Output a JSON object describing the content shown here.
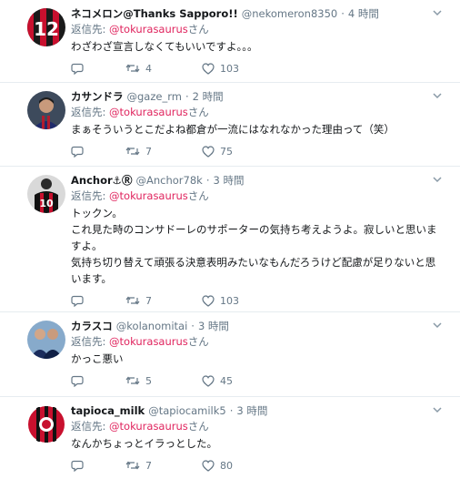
{
  "tweets": [
    {
      "name": "ネコメロン@Thanks Sapporo!!",
      "handle": "@nekomeron8350",
      "sep": "·",
      "time": "4 時間",
      "reply_prefix": "返信先: ",
      "reply_to": "@tokurasaurus",
      "reply_suffix": "さん",
      "text": "わざわざ宣言しなくてもいいですよ。。。",
      "retweets": "4",
      "likes": "103"
    },
    {
      "name": "カサンドラ",
      "handle": "@gaze_rm",
      "sep": "·",
      "time": "2 時間",
      "reply_prefix": "返信先: ",
      "reply_to": "@tokurasaurus",
      "reply_suffix": "さん",
      "text": "まぁそういうとこだよね都倉が一流にはなれなかった理由って（笑）",
      "retweets": "7",
      "likes": "75"
    },
    {
      "name": "Anchor⚓Ⓡ",
      "handle": "@Anchor78k",
      "sep": "·",
      "time": "3 時間",
      "reply_prefix": "返信先: ",
      "reply_to": "@tokurasaurus",
      "reply_suffix": "さん",
      "text_lines": [
        "トックン。",
        "これ見た時のコンサドーレのサポーターの気持ち考えようよ。寂しいと思いま",
        "すよ。",
        "気持ち切り替えて頑張る決意表明みたいなもんだろうけど配慮が足りないと思",
        "います。"
      ],
      "retweets": "7",
      "likes": "103"
    },
    {
      "name": "カラスコ",
      "handle": "@kolanomitai",
      "sep": "·",
      "time": "3 時間",
      "reply_prefix": "返信先: ",
      "reply_to": "@tokurasaurus",
      "reply_suffix": "さん",
      "text": "かっこ悪い",
      "retweets": "5",
      "likes": "45"
    },
    {
      "name": "tapioca_milk",
      "handle": "@tapiocamilk5",
      "sep": "·",
      "time": "3 時間",
      "reply_prefix": "返信先: ",
      "reply_to": "@tokurasaurus",
      "reply_suffix": "さん",
      "text": "なんかちょっとイラっとした。",
      "retweets": "7",
      "likes": "80"
    }
  ],
  "colors": {
    "mention": "#e0245e",
    "muted": "#657786",
    "divider": "#e6ecf0"
  },
  "icons": [
    "reply-icon",
    "retweet-icon",
    "like-icon",
    "chevron-down-icon"
  ]
}
